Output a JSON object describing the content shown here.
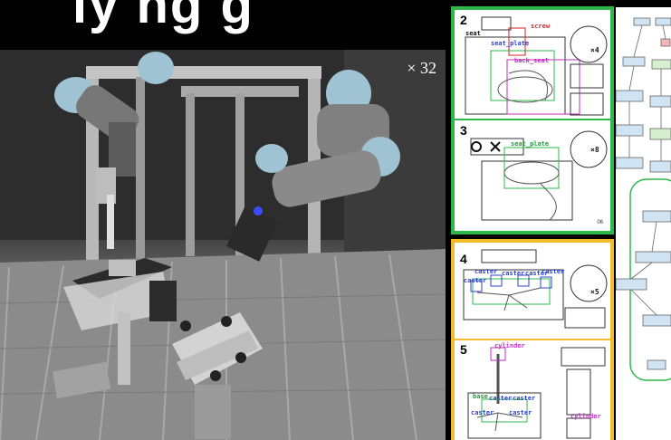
{
  "banner": {
    "title": "ly ng                      g"
  },
  "photo": {
    "speed": "× 32"
  },
  "manual": {
    "step2": {
      "number": "2",
      "tags": {
        "seat": "seat",
        "seat_plate": "seat_plate",
        "screw": "screw",
        "back_seat": "back_seat",
        "x4": "×4"
      }
    },
    "step3": {
      "number": "3",
      "tags": {
        "seat_plate": "seat_plate",
        "x8": "×8"
      },
      "page": "06"
    },
    "step4": {
      "number": "4",
      "tags": {
        "caster1": "caster",
        "caster2": "caster",
        "caster3": "caster",
        "caster4": "caster",
        "caster5": "caster",
        "x5": "×5"
      }
    },
    "step5": {
      "number": "5",
      "tags": {
        "cylinder_top": "cylinder",
        "base": "base",
        "caster1": "caster",
        "caster2": "caster",
        "caster3": "caster",
        "caster4": "caster",
        "cylinder_bottom": "cylinder"
      }
    }
  },
  "colors": {
    "green_border": "#2fb84a",
    "yellow_border": "#f1bb2a",
    "robot_joint": "#9fc3d3",
    "robot_arm": "#7a7a7a"
  }
}
